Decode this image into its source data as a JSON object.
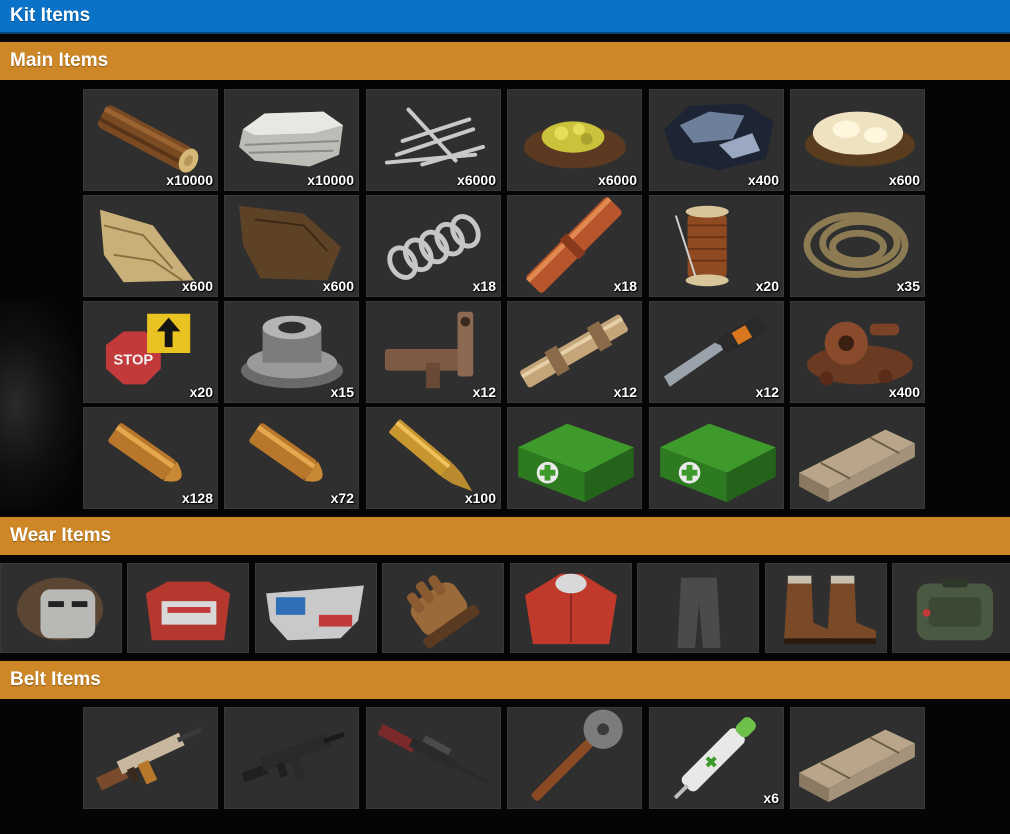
{
  "header": {
    "title": "Kit Items"
  },
  "sections": {
    "main": {
      "label": "Main Items"
    },
    "wear": {
      "label": "Wear Items"
    },
    "belt": {
      "label": "Belt Items"
    }
  },
  "main_items": [
    {
      "icon": "wood-log-icon",
      "qty": "x10000"
    },
    {
      "icon": "stone-icon",
      "qty": "x10000"
    },
    {
      "icon": "metal-fragments-icon",
      "qty": "x6000"
    },
    {
      "icon": "sulfur-ore-icon",
      "qty": "x6000"
    },
    {
      "icon": "high-quality-metal-ore-icon",
      "qty": "x400"
    },
    {
      "icon": "animal-fat-icon",
      "qty": "x600"
    },
    {
      "icon": "cloth-icon",
      "qty": "x600"
    },
    {
      "icon": "leather-icon",
      "qty": "x600"
    },
    {
      "icon": "metal-spring-icon",
      "qty": "x18"
    },
    {
      "icon": "pipe-icon",
      "qty": "x18"
    },
    {
      "icon": "sewing-kit-icon",
      "qty": "x20"
    },
    {
      "icon": "rope-icon",
      "qty": "x35"
    },
    {
      "icon": "road-signs-icon",
      "qty": "x20"
    },
    {
      "icon": "gears-icon",
      "qty": "x15"
    },
    {
      "icon": "smg-body-icon",
      "qty": "x12"
    },
    {
      "icon": "rifle-body-icon",
      "qty": "x12"
    },
    {
      "icon": "metal-blade-icon",
      "qty": "x12"
    },
    {
      "icon": "scrap-icon",
      "qty": "x400"
    },
    {
      "icon": "pistol-bullet-icon",
      "qty": "x128"
    },
    {
      "icon": "pistol-bullet-icon",
      "qty": "x72"
    },
    {
      "icon": "rifle-ammo-icon",
      "qty": "x100"
    },
    {
      "icon": "medical-box-icon",
      "qty": ""
    },
    {
      "icon": "medical-box-icon",
      "qty": ""
    },
    {
      "icon": "wooden-crate-icon",
      "qty": ""
    }
  ],
  "wear_items": [
    {
      "icon": "metal-facemask-icon"
    },
    {
      "icon": "roadsign-chestplate-icon"
    },
    {
      "icon": "roadsign-kilt-icon"
    },
    {
      "icon": "leather-gloves-icon"
    },
    {
      "icon": "hoodie-icon"
    },
    {
      "icon": "pants-icon"
    },
    {
      "icon": "boots-icon"
    },
    {
      "icon": "backpack-icon"
    }
  ],
  "belt_items": [
    {
      "icon": "assault-rifle-icon",
      "qty": ""
    },
    {
      "icon": "mp5-icon",
      "qty": ""
    },
    {
      "icon": "bolt-action-rifle-icon",
      "qty": ""
    },
    {
      "icon": "salvaged-axe-icon",
      "qty": ""
    },
    {
      "icon": "medical-syringe-icon",
      "qty": "x6"
    },
    {
      "icon": "wooden-crate-icon",
      "qty": ""
    }
  ],
  "colors": {
    "title_bar": "#0a73c8",
    "section_bar": "#cd8726",
    "slot_bg": "#2f2f2f",
    "page_bg": "#050505"
  }
}
